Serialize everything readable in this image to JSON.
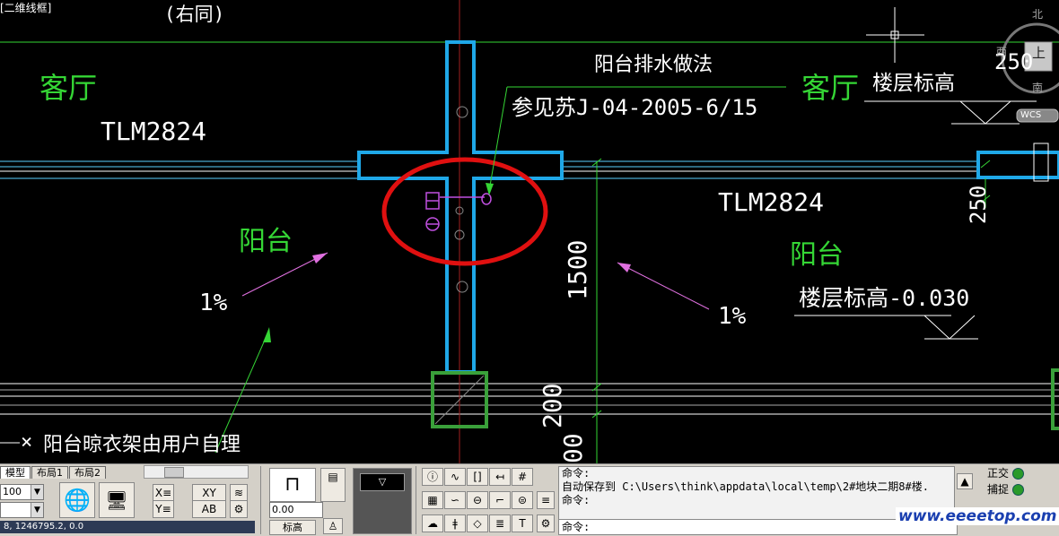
{
  "viewport": {
    "label": "[二维线框]",
    "top_note": "(右同)"
  },
  "drawing": {
    "room_left": "客厅",
    "room_right": "客厅",
    "window_left": "TLM2824",
    "window_right": "TLM2824",
    "balcony_left": "阳台",
    "balcony_right": "阳台",
    "slope_left": "1%",
    "slope_right": "1%",
    "drain_title": "阳台排水做法",
    "drain_ref": "参见苏J-04-2005-6/15",
    "floor_level_title": "楼层标高",
    "floor_level_value": "楼层标高-0.030",
    "dim_250_top": "250",
    "dim_250_side": "250",
    "dim_1500": "1500",
    "dim_200": "200",
    "dim_bottom": "00",
    "clothes_rack_note": "阳台晾衣架由用户自理",
    "compass_north": "北",
    "compass_west": "西",
    "compass_south": "南",
    "compass_top": "上",
    "wcs": "WCS"
  },
  "layout_tabs": [
    {
      "label": "模型"
    },
    {
      "label": "布局1"
    },
    {
      "label": "布局2"
    }
  ],
  "toolbar": {
    "scale_value": "100",
    "elevation_value": "0.00",
    "elevation_label": "标高",
    "xy_label": "XY",
    "ab_label": "AB",
    "coords": "8, 1246795.2, 0.0"
  },
  "command": {
    "lines": [
      "命令:",
      "自动保存到 C:\\Users\\think\\appdata\\local\\temp\\2#地块二期8#楼.",
      "命令:"
    ],
    "prompt": "命令:"
  },
  "status": {
    "ortho": "正交",
    "snap": "捕捉"
  },
  "watermark": "www.eeeetop.com",
  "colors": {
    "background": "#000000",
    "wall_outline": "#1fa8e8",
    "cloud": "#e01010",
    "dim_green": "#35d635",
    "leader_magenta": "#e070e0"
  }
}
